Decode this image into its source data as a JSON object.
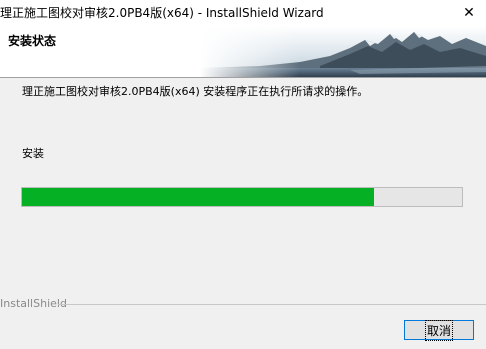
{
  "window": {
    "title": "理正施工图校对审核2.0PB4版(x64) - InstallShield Wizard",
    "close_glyph": "✕"
  },
  "banner": {
    "title": "安装状态"
  },
  "main": {
    "message": "理正施工图校对审核2.0PB4版(x64) 安装程序正在执行所请求的操作。",
    "stage_label": "安装",
    "progress_fraction": 0.8,
    "progress_color": "#06b025"
  },
  "footer": {
    "brand": "InstallShield",
    "cancel_label": "取消"
  }
}
